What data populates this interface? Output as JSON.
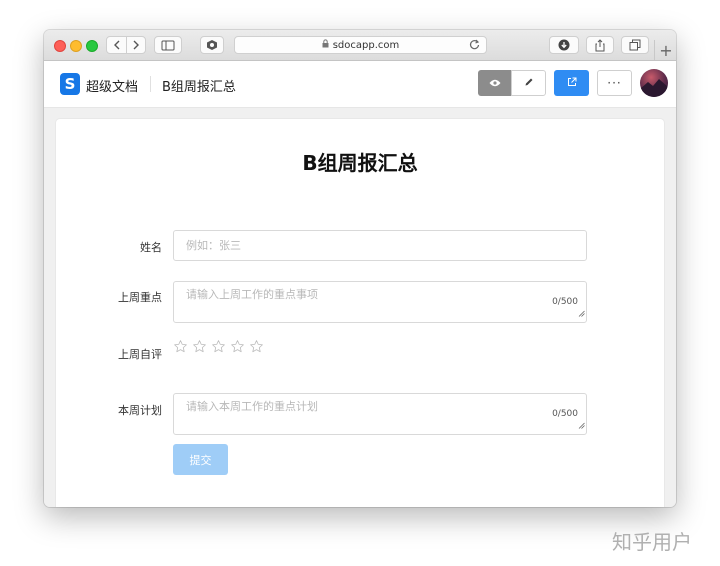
{
  "browser": {
    "url": "sdocapp.com"
  },
  "app": {
    "brand": "超级文档",
    "logo_letter": "S",
    "doc_title": "B组周报汇总",
    "more_label": "···"
  },
  "form": {
    "title": "B组周报汇总",
    "fields": [
      {
        "label": "姓名",
        "placeholder": "例如：张三"
      },
      {
        "label": "上周重点",
        "placeholder": "请输入上周工作的重点事项",
        "counter": "0/500"
      },
      {
        "label": "上周自评",
        "rating": 0,
        "max": 5
      },
      {
        "label": "本周计划",
        "placeholder": "请输入本周工作的重点计划",
        "counter": "0/500"
      }
    ],
    "submit_label": "提交"
  },
  "colors": {
    "accent": "#2f8cf3",
    "submit_disabled": "#9fcdf7",
    "logo": "#1677e6"
  },
  "watermark": "知乎用户"
}
